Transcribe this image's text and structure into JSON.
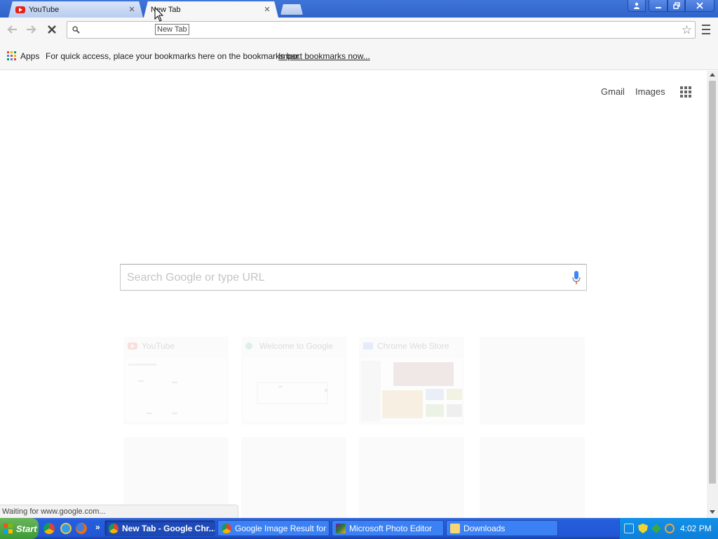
{
  "browser": {
    "tabs": [
      {
        "title": "YouTube",
        "active": false,
        "icon": "youtube-icon"
      },
      {
        "title": "New Tab",
        "active": true
      }
    ],
    "tab_tooltip": "New Tab",
    "omnibox": {
      "value": "",
      "placeholder": ""
    },
    "bookmarks": {
      "apps_label": "Apps",
      "hint": "For quick access, place your bookmarks here on the bookmarks bar.",
      "import_link": "Import bookmarks now..."
    },
    "status": "Waiting for www.google.com..."
  },
  "page": {
    "links": {
      "gmail": "Gmail",
      "images": "Images"
    },
    "search_placeholder": "Search Google or type URL",
    "tiles": [
      {
        "title": "YouTube"
      },
      {
        "title": "Welcome to Google"
      },
      {
        "title": "Chrome Web Store"
      },
      {
        "title": ""
      },
      {
        "title": ""
      },
      {
        "title": ""
      },
      {
        "title": ""
      },
      {
        "title": ""
      }
    ]
  },
  "taskbar": {
    "start_label": "Start",
    "tasks": [
      {
        "label": "New Tab - Google Chr...",
        "active": true
      },
      {
        "label": "Google Image Result for ...",
        "active": false
      },
      {
        "label": "Microsoft Photo Editor",
        "active": false
      },
      {
        "label": "Downloads",
        "active": false
      }
    ],
    "clock": "4:02 PM"
  },
  "colors": {
    "title_bar": "#2f63c9",
    "taskbar": "#245edb",
    "tray": "#0e7fd8",
    "start_green": "#3c9a35"
  }
}
